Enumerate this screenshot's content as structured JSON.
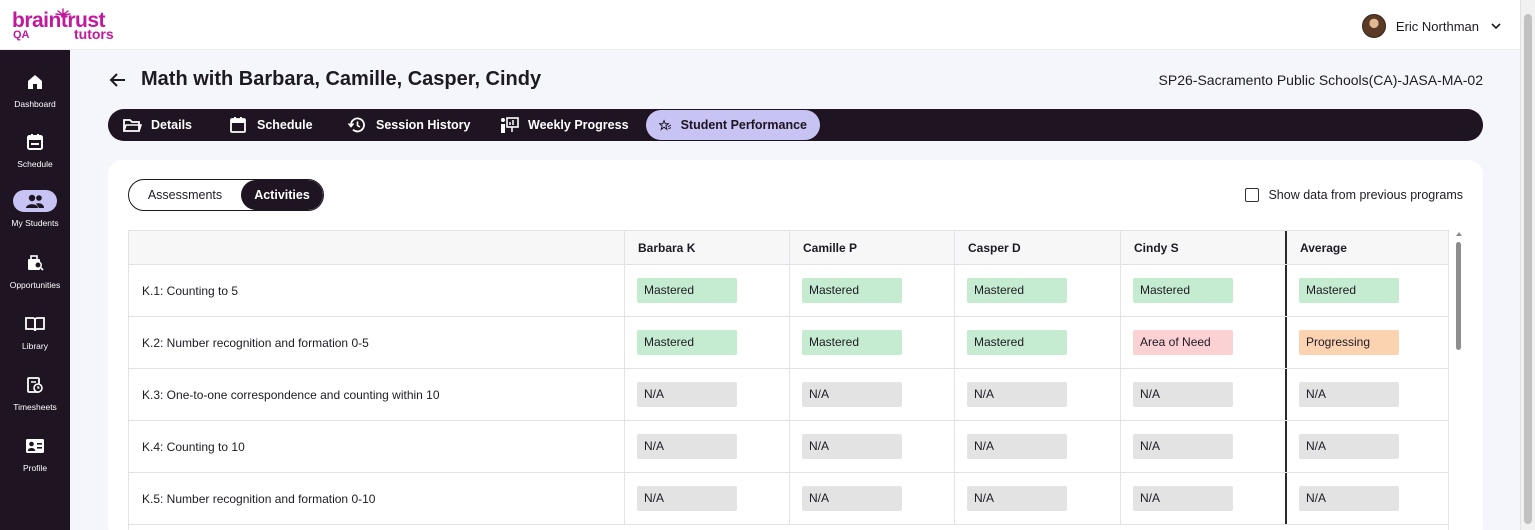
{
  "app": {
    "brand": "braintrust",
    "brand_sub_left": "QA",
    "brand_sub_right": "tutors"
  },
  "user": {
    "name": "Eric Northman"
  },
  "sidebar": {
    "items": [
      {
        "label": "Dashboard",
        "icon": "home-icon",
        "active": false
      },
      {
        "label": "Schedule",
        "icon": "calendar-icon",
        "active": false
      },
      {
        "label": "My Students",
        "icon": "students-icon",
        "active": true
      },
      {
        "label": "Opportunities",
        "icon": "briefcase-search-icon",
        "active": false
      },
      {
        "label": "Library",
        "icon": "book-icon",
        "active": false
      },
      {
        "label": "Timesheets",
        "icon": "timesheet-icon",
        "active": false
      },
      {
        "label": "Profile",
        "icon": "profile-card-icon",
        "active": false
      }
    ]
  },
  "page": {
    "title": "Math with Barbara, Camille, Casper, Cindy",
    "program_code": "SP26-Sacramento Public Schools(CA)-JASA-MA-02"
  },
  "tabs": [
    {
      "label": "Details",
      "icon": "folder-icon",
      "active": false
    },
    {
      "label": "Schedule",
      "icon": "calendar-icon",
      "active": false
    },
    {
      "label": "Session History",
      "icon": "history-icon",
      "active": false
    },
    {
      "label": "Weekly Progress",
      "icon": "presentation-icon",
      "active": false
    },
    {
      "label": "Student Performance",
      "icon": "star-chart-icon",
      "active": true
    }
  ],
  "toggle": {
    "options": [
      "Assessments",
      "Activities"
    ],
    "selected": "Activities"
  },
  "checkbox": {
    "label": "Show data from previous programs",
    "checked": false
  },
  "table": {
    "columns": [
      "",
      "Barbara K",
      "Camille P",
      "Casper D",
      "Cindy S",
      "Average"
    ],
    "rows": [
      {
        "skill": "K.1: Counting to 5",
        "values": [
          "Mastered",
          "Mastered",
          "Mastered",
          "Mastered",
          "Mastered"
        ]
      },
      {
        "skill": "K.2: Number recognition and formation 0-5",
        "values": [
          "Mastered",
          "Mastered",
          "Mastered",
          "Area of Need",
          "Progressing"
        ]
      },
      {
        "skill": "K.3: One-to-one correspondence and counting within 10",
        "values": [
          "N/A",
          "N/A",
          "N/A",
          "N/A",
          "N/A"
        ]
      },
      {
        "skill": "K.4: Counting to 10",
        "values": [
          "N/A",
          "N/A",
          "N/A",
          "N/A",
          "N/A"
        ]
      },
      {
        "skill": "K.5: Number recognition and formation 0-10",
        "values": [
          "N/A",
          "N/A",
          "N/A",
          "N/A",
          "N/A"
        ]
      }
    ]
  },
  "status_colors": {
    "Mastered": "#c5ecd0",
    "Area of Need": "#fbd1d3",
    "Progressing": "#fcd3b1",
    "N/A": "#e3e3e3"
  },
  "colors": {
    "brand": "#c2189b",
    "nav_dark": "#1e1422",
    "accent": "#c7c3f2"
  }
}
